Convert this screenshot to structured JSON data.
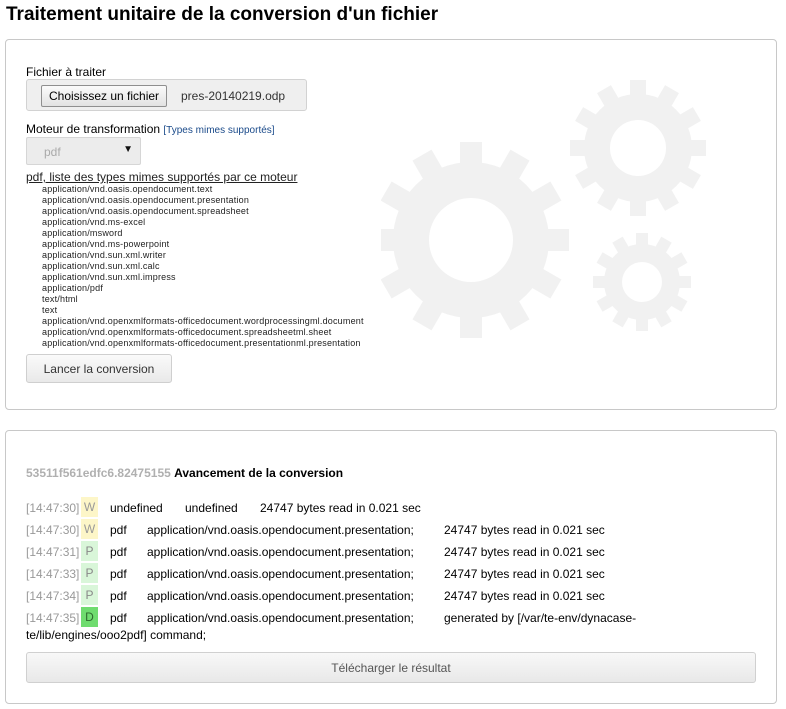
{
  "page": {
    "title": "Traitement unitaire de la conversion d'un fichier"
  },
  "form": {
    "file_label": "Fichier à traiter",
    "file_button": "Choisissez un fichier",
    "file_name": "pres-20140219.odp",
    "engine_label": "Moteur de transformation",
    "mime_link": "[Types mimes supportés]",
    "engine_value": "pdf",
    "mime_title": "pdf, liste des types mimes supportés par ce moteur",
    "mime_types": [
      "application/vnd.oasis.opendocument.text",
      "application/vnd.oasis.opendocument.presentation",
      "application/vnd.oasis.opendocument.spreadsheet",
      "application/vnd.ms-excel",
      "application/msword",
      "application/vnd.ms-powerpoint",
      "application/vnd.sun.xml.writer",
      "application/vnd.sun.xml.calc",
      "application/vnd.sun.xml.impress",
      "application/pdf",
      "text/html",
      "text",
      "application/vnd.openxmlformats-officedocument.wordprocessingml.document",
      "application/vnd.openxmlformats-officedocument.spreadsheetml.sheet",
      "application/vnd.openxmlformats-officedocument.presentationml.presentation"
    ],
    "launch_button": "Lancer la conversion"
  },
  "progress": {
    "id": "53511f561edfc6.82475155",
    "heading": "Avancement de la conversion",
    "rows": [
      {
        "time": "[14:47:30]",
        "status": "W",
        "engine": "undefined",
        "mime": "undefined",
        "msg": "24747 bytes read in 0.021 sec"
      },
      {
        "time": "[14:47:30]",
        "status": "W",
        "engine": "pdf",
        "mime": "application/vnd.oasis.opendocument.presentation;",
        "msg": "24747 bytes read in 0.021 sec"
      },
      {
        "time": "[14:47:31]",
        "status": "P",
        "engine": "pdf",
        "mime": "application/vnd.oasis.opendocument.presentation;",
        "msg": "24747 bytes read in 0.021 sec"
      },
      {
        "time": "[14:47:33]",
        "status": "P",
        "engine": "pdf",
        "mime": "application/vnd.oasis.opendocument.presentation;",
        "msg": "24747 bytes read in 0.021 sec"
      },
      {
        "time": "[14:47:34]",
        "status": "P",
        "engine": "pdf",
        "mime": "application/vnd.oasis.opendocument.presentation;",
        "msg": "24747 bytes read in 0.021 sec"
      },
      {
        "time": "[14:47:35]",
        "status": "D",
        "engine": "pdf",
        "mime": "application/vnd.oasis.opendocument.presentation;",
        "msg": "generated by [/var/te-env/dynacase-"
      }
    ],
    "msg_continuation": "te/lib/engines/ooo2pdf] command;",
    "download_button": "Télécharger le résultat"
  }
}
